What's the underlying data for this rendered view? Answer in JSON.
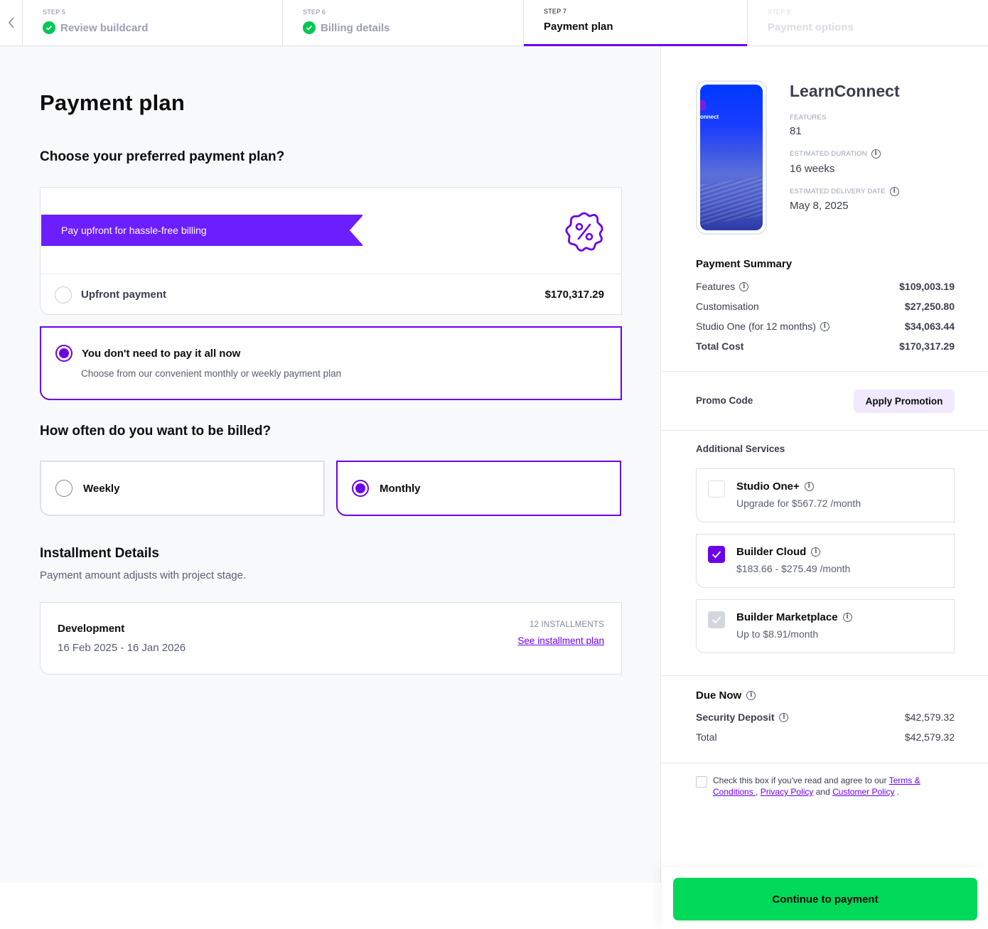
{
  "stepper": {
    "back_label": "<",
    "steps": [
      {
        "num": "STEP 5",
        "title": "Review buildcard",
        "state": "completed"
      },
      {
        "num": "STEP 6",
        "title": "Billing details",
        "state": "completed"
      },
      {
        "num": "STEP 7",
        "title": "Payment plan",
        "state": "active"
      },
      {
        "num": "STEP 8",
        "title": "Payment options",
        "state": "disabled"
      }
    ]
  },
  "main": {
    "title": "Payment plan",
    "plan_question": "Choose your preferred payment plan?",
    "upfront": {
      "ribbon": "Pay upfront for hassle-free billing",
      "icon": "discount-badge-icon",
      "label": "Upfront payment",
      "price": "$170,317.29",
      "selected": false
    },
    "installment": {
      "label": "You don't need to pay it all now",
      "description": "Choose from our convenient monthly or weekly payment plan",
      "selected": true
    },
    "frequency_question": "How often do you want to be billed?",
    "frequency": {
      "options": [
        {
          "label": "Weekly",
          "selected": false
        },
        {
          "label": "Monthly",
          "selected": true
        }
      ]
    },
    "installment_details": {
      "title": "Installment Details",
      "subtitle": "Payment amount adjusts with project stage.",
      "stage": "Development",
      "dates": "16 Feb 2025 - 16 Jan 2026",
      "count": "12 INSTALLMENTS",
      "link": "See installment plan"
    }
  },
  "sidebar": {
    "project": {
      "name": "LearnConnect",
      "preview_text": "onnect",
      "features_label": "FEATURES",
      "features_value": "81",
      "duration_label": "ESTIMATED DURATION",
      "duration_value": "16 weeks",
      "delivery_label": "ESTIMATED DELIVERY DATE",
      "delivery_value": "May 8, 2025"
    },
    "payment_summary": {
      "title": "Payment Summary",
      "rows": [
        {
          "label": "Features",
          "value": "$109,003.19",
          "info": true
        },
        {
          "label": "Customisation",
          "value": "$27,250.80",
          "info": false
        },
        {
          "label": "Studio One (for 12 months)",
          "value": "$34,063.44",
          "info": true
        },
        {
          "label": "Total Cost",
          "value": "$170,317.29",
          "info": false
        }
      ]
    },
    "promo": {
      "label": "Promo Code",
      "button": "Apply Promotion"
    },
    "additional_services": {
      "title": "Additional Services",
      "items": [
        {
          "name": "Studio One+",
          "price": "Upgrade for $567.72 /month",
          "state": "unchecked"
        },
        {
          "name": "Builder Cloud",
          "price": "$183.66 - $275.49 /month",
          "state": "checked"
        },
        {
          "name": "Builder Marketplace",
          "price": "Up to $8.91/month",
          "state": "disabled-checked"
        }
      ]
    },
    "due_now": {
      "title": "Due Now",
      "deposit_label": "Security Deposit",
      "deposit_value": "$42,579.32",
      "total_label": "Total",
      "total_value": "$42,579.32"
    },
    "terms": {
      "prefix": "Check this box if you've read and agree to our ",
      "terms_link": "Terms & Conditions ",
      "sep1": ", ",
      "privacy_link": "Privacy Policy",
      "sep2": " and ",
      "customer_link": "Customer Policy",
      "suffix": " .",
      "checked": false
    },
    "continue_button": "Continue to payment"
  },
  "colors": {
    "accent": "#6c00ea",
    "ribbon": "#6c1eff",
    "success": "#00c853",
    "cta": "#00d95a",
    "promo_bg": "#f0e9ff"
  }
}
